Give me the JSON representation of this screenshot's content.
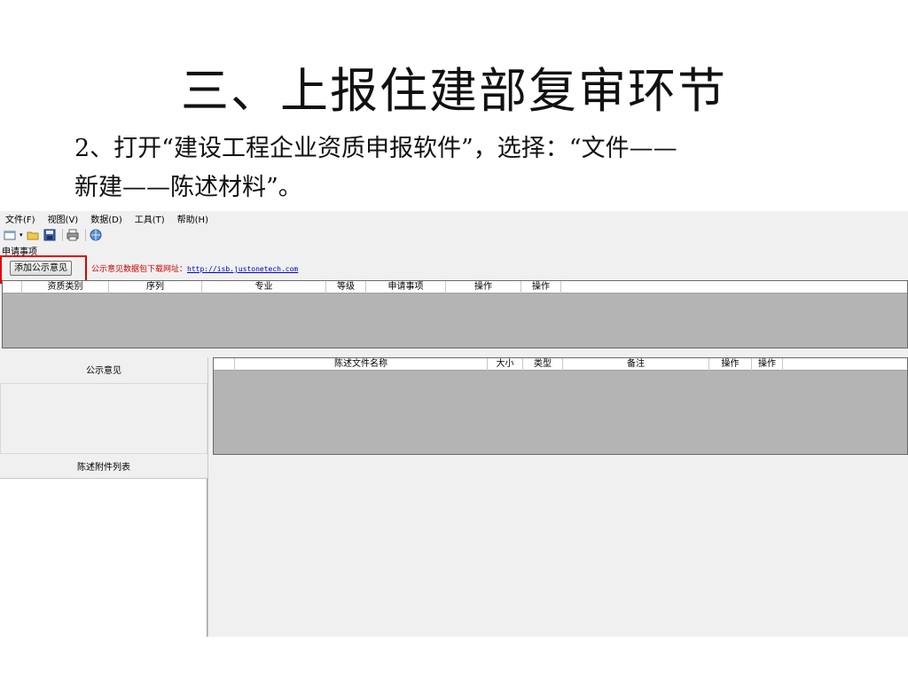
{
  "slide": {
    "title": "三、上报住建部复审环节",
    "body_line1": "2、打开“建设工程企业资质申报软件”，选择：“文件——",
    "body_line2": "新建——陈述材料”。"
  },
  "app": {
    "menu": [
      "文件(F)",
      "视图(V)",
      "数据(D)",
      "工具(T)",
      "帮助(H)"
    ],
    "toolbar_icons": [
      "new-icon",
      "open-folder-icon",
      "save-icon",
      "print-icon",
      "globe-icon"
    ],
    "section_label": "申请事项",
    "add_button": "添加公示意见",
    "download_prefix": "公示意见数据包下载网址：",
    "download_url": "http://isb.justonetech.com",
    "grid1_headers": [
      "",
      "资质类别",
      "序列",
      "专业",
      "等级",
      "申请事项",
      "操作",
      "操作"
    ],
    "opinion_panel_title": "公示意见",
    "grid2_headers": [
      "",
      "陈述文件名称",
      "大小",
      "类型",
      "备注",
      "操作",
      "操作"
    ],
    "attachment_panel_title": "陈述附件列表"
  },
  "colors": {
    "highlight": "#e00000",
    "link": "#0000cc",
    "grid_bg": "#b4b4b4",
    "notice_text": "#cc0000"
  }
}
